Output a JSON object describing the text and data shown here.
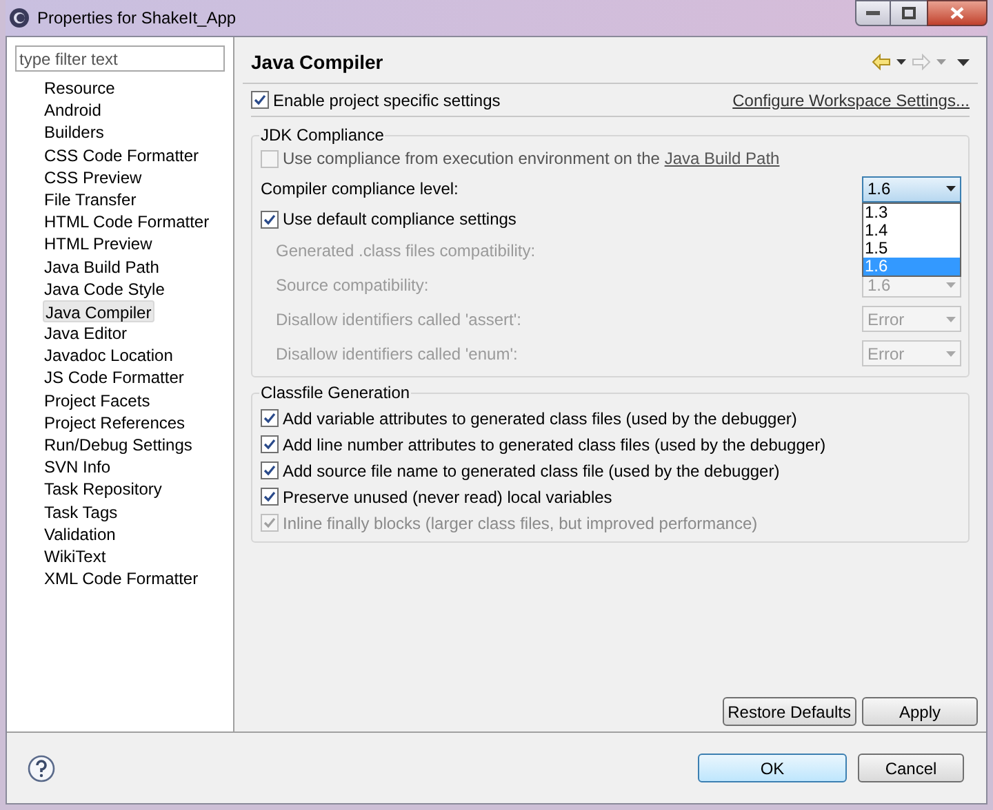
{
  "window": {
    "title": "Properties for ShakeIt_App"
  },
  "filter": {
    "placeholder": "type filter text"
  },
  "tree": [
    {
      "label": "Resource",
      "selected": false
    },
    {
      "label": "Android",
      "selected": false
    },
    {
      "label": "Builders",
      "selected": false
    },
    {
      "label": "CSS Code Formatter",
      "selected": false
    },
    {
      "label": "CSS Preview",
      "selected": false
    },
    {
      "label": "File Transfer",
      "selected": false
    },
    {
      "label": "HTML Code Formatter",
      "selected": false
    },
    {
      "label": "HTML Preview",
      "selected": false
    },
    {
      "label": "Java Build Path",
      "selected": false
    },
    {
      "label": "Java Code Style",
      "selected": false
    },
    {
      "label": "Java Compiler",
      "selected": true
    },
    {
      "label": "Java Editor",
      "selected": false
    },
    {
      "label": "Javadoc Location",
      "selected": false
    },
    {
      "label": "JS Code Formatter",
      "selected": false
    },
    {
      "label": "Project Facets",
      "selected": false
    },
    {
      "label": "Project References",
      "selected": false
    },
    {
      "label": "Run/Debug Settings",
      "selected": false
    },
    {
      "label": "SVN Info",
      "selected": false
    },
    {
      "label": "Task Repository",
      "selected": false
    },
    {
      "label": "Task Tags",
      "selected": false
    },
    {
      "label": "Validation",
      "selected": false
    },
    {
      "label": "WikiText",
      "selected": false
    },
    {
      "label": "XML Code Formatter",
      "selected": false
    }
  ],
  "page": {
    "title": "Java Compiler",
    "enable_project_specific": {
      "label": "Enable project specific settings",
      "checked": true
    },
    "configure_link": "Configure Workspace Settings...",
    "jdk_compliance": {
      "title": "JDK Compliance",
      "use_execution_env": {
        "label": "Use compliance from execution environment on the ",
        "link": "Java Build Path",
        "checked": false,
        "disabled": true
      },
      "compliance_level": {
        "label": "Compiler compliance level:",
        "value": "1.6",
        "options": [
          {
            "label": "1.3",
            "selected": false
          },
          {
            "label": "1.4",
            "selected": false
          },
          {
            "label": "1.5",
            "selected": false
          },
          {
            "label": "1.6",
            "selected": true
          }
        ]
      },
      "use_default": {
        "label": "Use default compliance settings",
        "checked": true
      },
      "settings": [
        {
          "label": "Generated .class files compatibility:"
        },
        {
          "label": "Source compatibility:",
          "value": "1.6"
        },
        {
          "label": "Disallow identifiers called 'assert':",
          "value": "Error"
        },
        {
          "label": "Disallow identifiers called 'enum':",
          "value": "Error"
        }
      ]
    },
    "classfile_generation": {
      "title": "Classfile Generation",
      "options": [
        {
          "label": "Add variable attributes to generated class files (used by the debugger)",
          "checked": true,
          "disabled": false
        },
        {
          "label": "Add line number attributes to generated class files (used by the debugger)",
          "checked": true,
          "disabled": false
        },
        {
          "label": "Add source file name to generated class file (used by the debugger)",
          "checked": true,
          "disabled": false
        },
        {
          "label": "Preserve unused (never read) local variables",
          "checked": true,
          "disabled": false
        },
        {
          "label": "Inline finally blocks (larger class files, but improved performance)",
          "checked": true,
          "disabled": true
        }
      ]
    }
  },
  "page_buttons": [
    "Restore Defaults",
    "Apply"
  ],
  "dialog_buttons": [
    {
      "label": "OK",
      "default": true
    },
    {
      "label": "Cancel",
      "default": false
    }
  ]
}
